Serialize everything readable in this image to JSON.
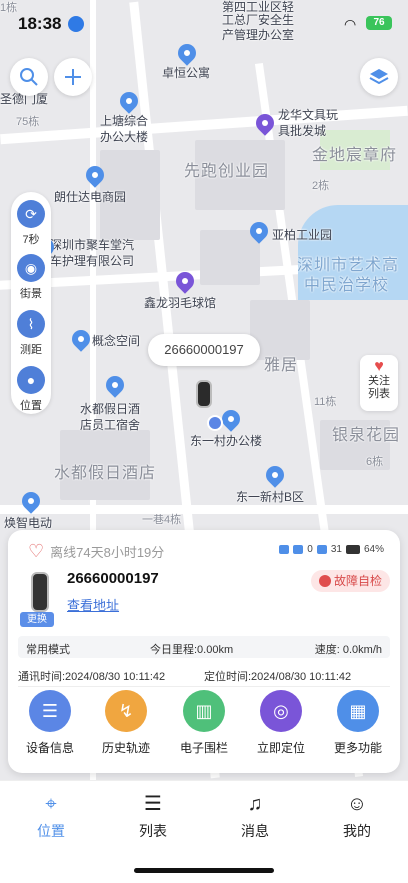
{
  "status_bar": {
    "time": "18:38",
    "battery": "76"
  },
  "map": {
    "labels": {
      "l1": "第四工业区轻",
      "l2": "工总厂安全生",
      "l3": "产管理办公室",
      "l4": "圣德门厦",
      "l5": "卓恒公寓",
      "l6": "75栋",
      "l7": "上塘综合",
      "l8": "办公大楼",
      "l9": "龙华文具玩",
      "l10": "具批发城",
      "l11": "金地宸章府",
      "l12": "先跑创业园",
      "l13": "朗仕达电商园",
      "l14": "2栋",
      "l15": "深圳市聚车堂汽",
      "l16": "车护理有限公司",
      "l17": "亚柏工业园",
      "l18": "深圳市艺术高",
      "l19": "中民治学校",
      "l20": "鑫龙羽毛球馆",
      "l21": "概念空间",
      "l22": "雅居",
      "l23": "11栋",
      "l24": "银泉花园",
      "l25": "6栋",
      "l26": "水都假日酒",
      "l27": "店员工宿舍",
      "l28": "东一村办公楼",
      "l29": "水都假日酒店",
      "l30": "东一新村B区",
      "l31": "焕智电动",
      "l32": "一巷4栋",
      "l33": "1栋"
    },
    "tools": [
      {
        "label": "7秒",
        "icon": "refresh-icon"
      },
      {
        "label": "街景",
        "icon": "street-view-icon"
      },
      {
        "label": "测距",
        "icon": "ruler-icon"
      },
      {
        "label": "位置",
        "icon": "location-icon"
      }
    ],
    "follow": {
      "line1": "关注",
      "line2": "列表"
    },
    "device_bubble": "26660000197"
  },
  "card": {
    "offline": "离线74天8小时19分",
    "gps_count": "0",
    "signal_count": "31",
    "battery": "64%",
    "device_id": "26660000197",
    "change": "更换",
    "address_link": "查看地址",
    "fault": "故障自检",
    "mode": "常用模式",
    "mileage": "今日里程:0.00km",
    "speed": "速度: 0.0km/h",
    "comm_time": "通讯时间:2024/08/30 10:11:42",
    "loc_time": "定位时间:2024/08/30 10:11:42",
    "actions": [
      {
        "label": "设备信息",
        "color": "#5b86e5",
        "icon": "device-info-icon"
      },
      {
        "label": "历史轨迹",
        "color": "#f0a640",
        "icon": "history-track-icon"
      },
      {
        "label": "电子围栏",
        "color": "#4fc07a",
        "icon": "fence-icon"
      },
      {
        "label": "立即定位",
        "color": "#7a55d8",
        "icon": "locate-now-icon"
      },
      {
        "label": "更多功能",
        "color": "#4f8fe8",
        "icon": "more-icon"
      }
    ]
  },
  "tabbar": {
    "tabs": [
      {
        "label": "位置",
        "icon": "map-pin-icon"
      },
      {
        "label": "列表",
        "icon": "list-icon"
      },
      {
        "label": "消息",
        "icon": "bell-icon"
      },
      {
        "label": "我的",
        "icon": "user-icon"
      }
    ]
  }
}
